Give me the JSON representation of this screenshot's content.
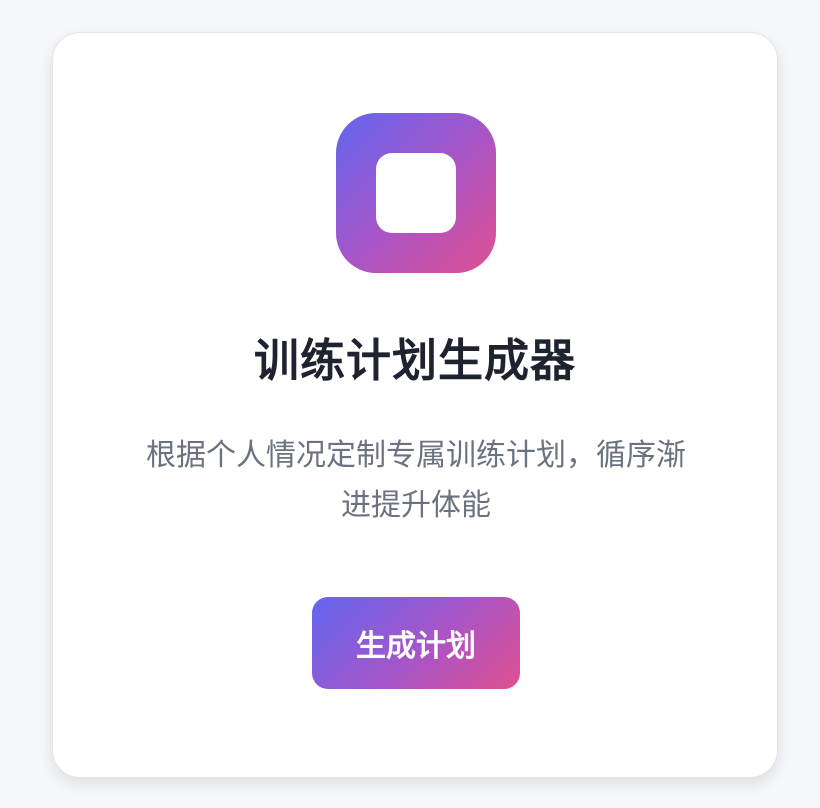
{
  "card": {
    "title": "训练计划生成器",
    "description": "根据个人情况定制专属训练计划，循序渐进提升体能",
    "button_label": "生成计划"
  },
  "icon": {
    "name": "app-logo-icon",
    "gradient": [
      "#6366f1",
      "#a855c7",
      "#e0508f"
    ]
  },
  "colors": {
    "background": "#f6f7f9",
    "card": "#ffffff",
    "title": "#1f2330",
    "description": "#6b7280",
    "button_text": "#ffffff"
  }
}
